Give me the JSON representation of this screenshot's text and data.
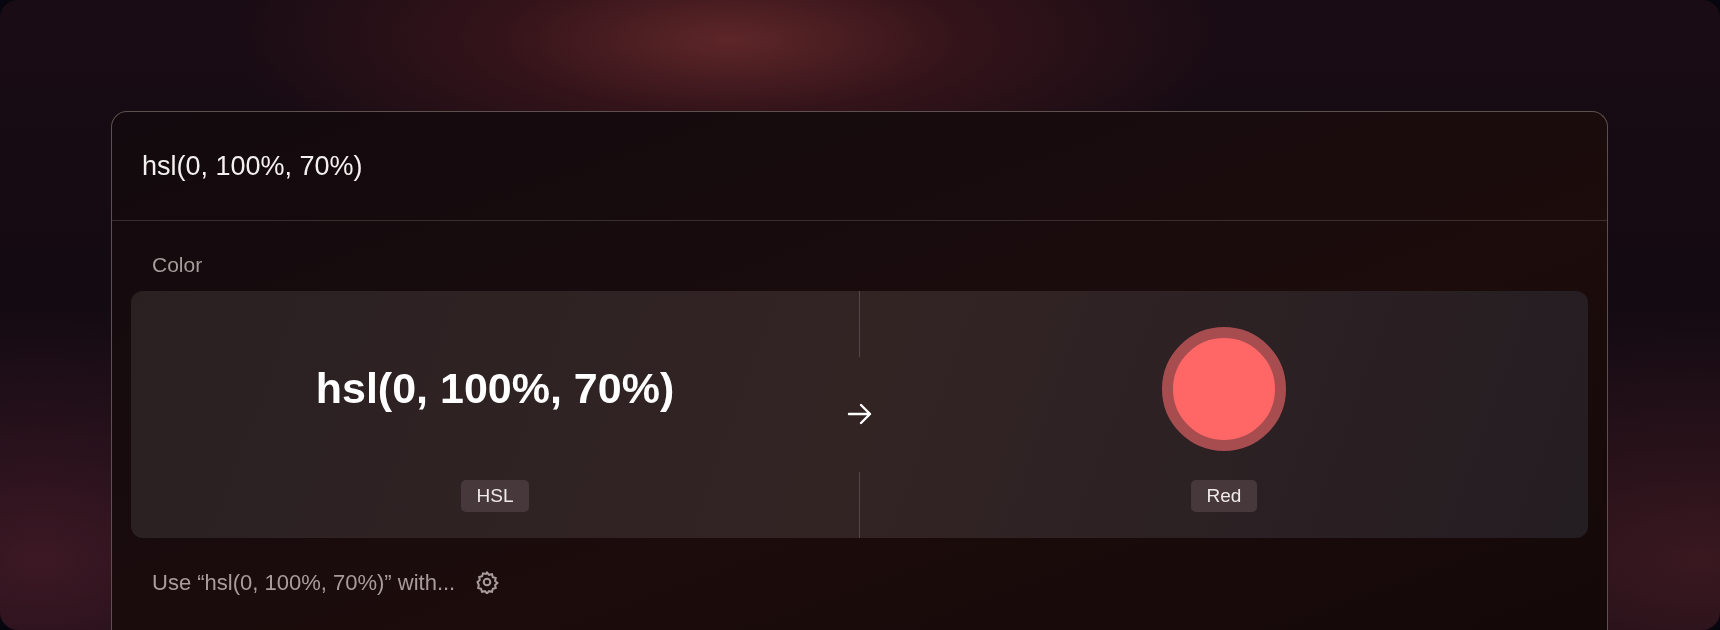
{
  "search": {
    "value": "hsl(0, 100%, 70%)"
  },
  "section": {
    "title": "Color"
  },
  "conversion": {
    "input": {
      "text": "hsl(0, 100%, 70%)",
      "format": "HSL"
    },
    "output": {
      "color": "#ff6666",
      "name": "Red"
    }
  },
  "footer": {
    "text": "Use “hsl(0, 100%, 70%)” with..."
  }
}
